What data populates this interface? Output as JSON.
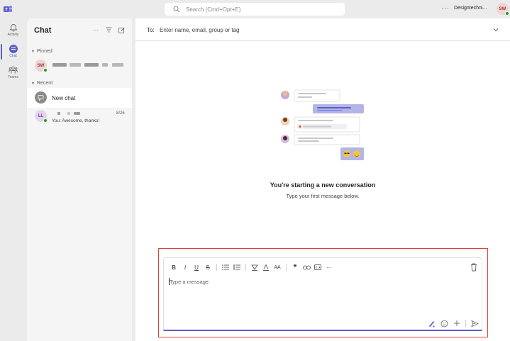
{
  "topbar": {
    "search_placeholder": "Search (Cmd+Opt+E)",
    "more": "···",
    "org_name": "Designtechni...",
    "user_initials": "SW"
  },
  "rail": {
    "items": [
      {
        "label": "Activity",
        "icon": "bell-icon"
      },
      {
        "label": "Chat",
        "icon": "chat-icon",
        "active": true
      },
      {
        "label": "Teams",
        "icon": "teams-icon"
      }
    ]
  },
  "chat_list": {
    "title": "Chat",
    "pinned_header": "Pinned",
    "pinned": [
      {
        "initials": "SW"
      }
    ],
    "recent_header": "Recent",
    "new_chat_label": "New chat",
    "recent": [
      {
        "initials": "LL",
        "date": "8/26",
        "preview": "You: Awesome, thanks!"
      }
    ]
  },
  "main": {
    "to_label": "To:",
    "to_placeholder": "Enter name, email, group or tag",
    "empty_title": "You're starting a new conversation",
    "empty_subtitle": "Type your first message below.",
    "composer": {
      "placeholder": "Type a message",
      "format_buttons": [
        "B",
        "I",
        "U",
        "S",
        "bullets",
        "numbers",
        "highlight",
        "font-color",
        "font-size",
        "quote",
        "link",
        "code",
        "more"
      ]
    }
  },
  "colors": {
    "brand": "#5b5fc7",
    "highlight_border": "#d9443a",
    "presence_online": "#13a10e"
  }
}
